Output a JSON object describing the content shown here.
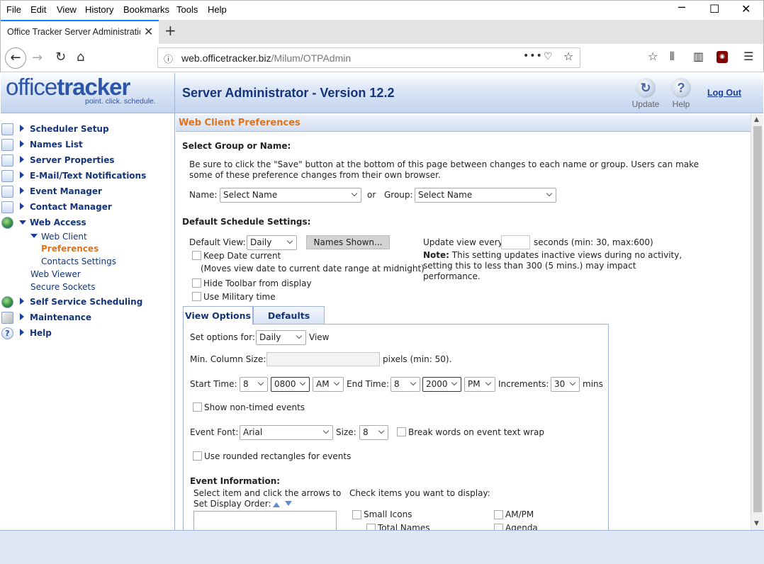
{
  "browser": {
    "menu": [
      "File",
      "Edit",
      "View",
      "History",
      "Bookmarks",
      "Tools",
      "Help"
    ],
    "tab_title": "Office Tracker Server Administration",
    "url_host": "web.officetracker.biz",
    "url_path": "/Milum/OTPAdmin"
  },
  "header": {
    "logo_text_a": "office",
    "logo_text_b": "tracker",
    "logo_tagline": "point. click. schedule.",
    "title": "Server Administrator - Version 12.2",
    "update_label": "Update",
    "help_label": "Help",
    "logout_label": "Log Out"
  },
  "sidebar": {
    "items": [
      {
        "label": "Scheduler Setup"
      },
      {
        "label": "Names List"
      },
      {
        "label": "Server Properties"
      },
      {
        "label": "E-Mail/Text Notifications"
      },
      {
        "label": "Event Manager"
      },
      {
        "label": "Contact Manager"
      },
      {
        "label": "Web Access"
      },
      {
        "label": "Self Service Scheduling"
      },
      {
        "label": "Maintenance"
      },
      {
        "label": "Help"
      }
    ],
    "sub": {
      "web_client": "Web Client",
      "preferences": "Preferences",
      "contacts_settings": "Contacts Settings",
      "web_viewer": "Web Viewer",
      "secure_sockets": "Secure Sockets"
    }
  },
  "main": {
    "section_title": "Web Client Preferences",
    "select_heading": "Select Group or Name:",
    "intro_line1": "Be sure to click the \"Save\" button at the bottom of this page between changes to each name or group. Users can make",
    "intro_line2": "some of these preference changes from their own browser.",
    "name_label": "Name:",
    "name_value": "Select Name",
    "or_label": "or",
    "group_label": "Group:",
    "group_value": "Select Name",
    "defaults_heading": "Default Schedule Settings:",
    "default_view_label": "Default View:",
    "default_view_value": "Daily",
    "names_shown_button": "Names Shown...",
    "keep_date_label": "Keep Date current",
    "keep_date_note": "(Moves view date to current date range at midnight)",
    "hide_toolbar_label": "Hide Toolbar from display",
    "military_label": "Use Military time",
    "update_view_label": "Update view every",
    "update_view_suffix": "seconds (min: 30, max:600)",
    "note_bold": "Note:",
    "note_line1": "This setting updates inactive views during no activity,",
    "note_line2": "setting this to less than 300 (5 mins.) may impact",
    "note_line3": "performance.",
    "tabs": [
      "View Options",
      "Defaults"
    ],
    "set_options_label": "Set options for:",
    "set_options_value": "Daily",
    "view_label": "View",
    "min_col_label": "Min. Column Size:",
    "min_col_suffix": "pixels (min: 50).",
    "start_time_label": "Start Time:",
    "start_hour": "8",
    "start_min": "0800",
    "start_ampm": "AM",
    "end_time_label": "End Time:",
    "end_hour": "8",
    "end_min": "2000",
    "end_ampm": "PM",
    "increments_label": "Increments:",
    "increments_value": "30",
    "mins_label": "mins",
    "non_timed_label": "Show non-timed events",
    "event_font_label": "Event Font:",
    "event_font_value": "Arial",
    "size_label": "Size:",
    "size_value": "8",
    "break_words_label": "Break words on event text wrap",
    "rounded_label": "Use rounded rectangles for events",
    "event_info_heading": "Event Information:",
    "order_line1": "Select item and click the arrows to",
    "order_line2": "Set Display Order:",
    "check_items_label": "Check items you want to display:",
    "small_icons_label": "Small Icons",
    "total_names_label": "Total Names",
    "ampm_label": "AM/PM",
    "agenda_label": "Agenda"
  }
}
